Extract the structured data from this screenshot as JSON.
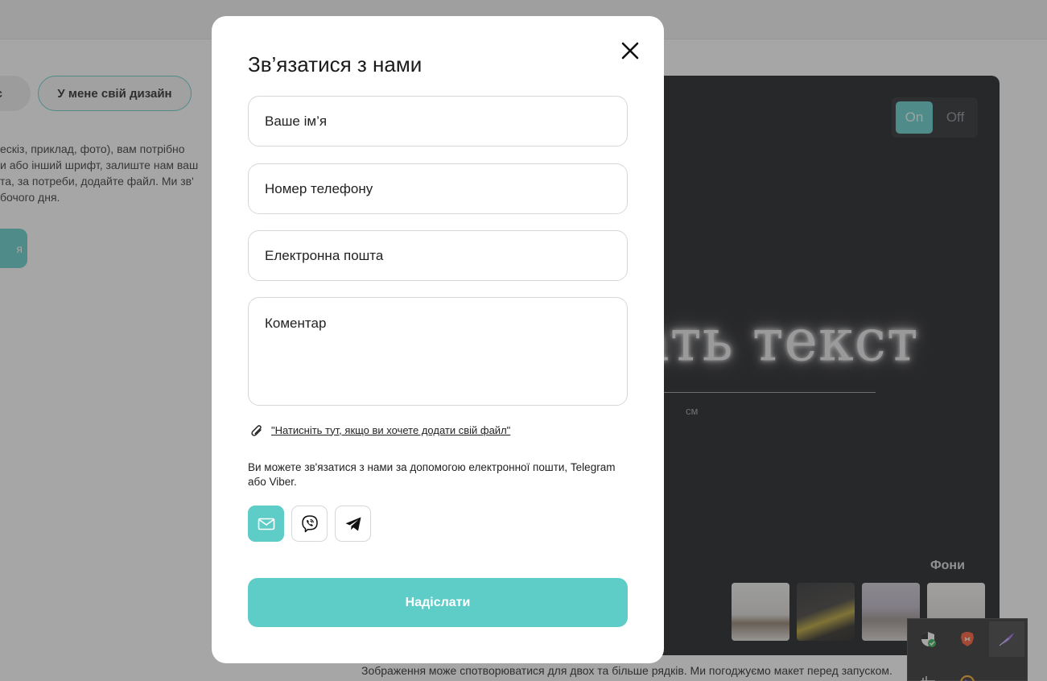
{
  "background": {
    "pill_partial": "с",
    "pill_own_design": "У мене свій дизайн",
    "description_lines": [
      "ескіз, приклад, фото), вам потрібно",
      "и або інший шрифт, залиште нам ваш",
      "та, за потреби, додайте файл. Ми зв'",
      "бочого дня."
    ],
    "teal_button_partial": "я",
    "preview": {
      "toggle_on": "On",
      "toggle_off": "Off",
      "neon_text": "ать текст",
      "measure_unit": "см",
      "backgrounds_label": "Фони",
      "thumbnails": [
        "interior-1",
        "interior-2",
        "interior-3",
        "interior-4"
      ]
    },
    "bottom_note": "Зображення може спотворюватися для двох та більше рядків. Ми погоджуємо макет перед запуском."
  },
  "modal": {
    "title": "Зв’язатися з нами",
    "fields": {
      "name_placeholder": "Ваше ім’я",
      "phone_placeholder": "Номер телефону",
      "email_placeholder": "Електронна пошта",
      "comment_placeholder": "Коментар"
    },
    "attach_link": "\"Натисніть тут, якщо ви хочете додати свій файл\"",
    "contact_note": "Ви можете зв'язатися з нами за допомогою електронної пошти, Telegram або Viber.",
    "contact_methods": [
      "mail-icon",
      "viber-icon",
      "telegram-icon"
    ],
    "submit_label": "Надіслати"
  },
  "colors": {
    "accent": "#5ecdc8",
    "preview_bg": "#16171b",
    "overlay": "rgba(60,60,60,0.46)"
  }
}
